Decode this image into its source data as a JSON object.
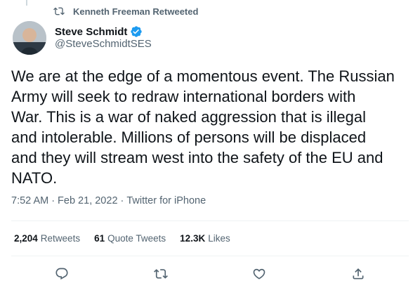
{
  "retweet_context": {
    "label": "Kenneth Freeman Retweeted"
  },
  "author": {
    "display_name": "Steve Schmidt",
    "handle": "@SteveSchmidtSES"
  },
  "tweet": {
    "text": "We are at the edge of a momentous event. The Russian\nArmy will seek to redraw international borders with\nWar. This is a war of naked aggression that is illegal\nand intolerable. Millions of persons will be displaced\nand they will stream west into the safety of the EU and\nNATO.",
    "time": "7:52 AM",
    "date": "Feb 21, 2022",
    "source": "Twitter for iPhone",
    "separator": "·"
  },
  "stats": {
    "retweets": {
      "count": "2,204",
      "label": "Retweets"
    },
    "quotes": {
      "count": "61",
      "label": "Quote Tweets"
    },
    "likes": {
      "count": "12.3K",
      "label": "Likes"
    }
  },
  "icons": {
    "retweet_context": "retweet-icon",
    "verified": "verified-badge-icon",
    "reply": "reply-icon",
    "retweet": "retweet-icon",
    "like": "like-icon",
    "share": "share-icon"
  },
  "colors": {
    "text_primary": "#0f1419",
    "text_secondary": "#536471",
    "verified_blue": "#1d9bf0",
    "divider": "#eff3f4"
  }
}
